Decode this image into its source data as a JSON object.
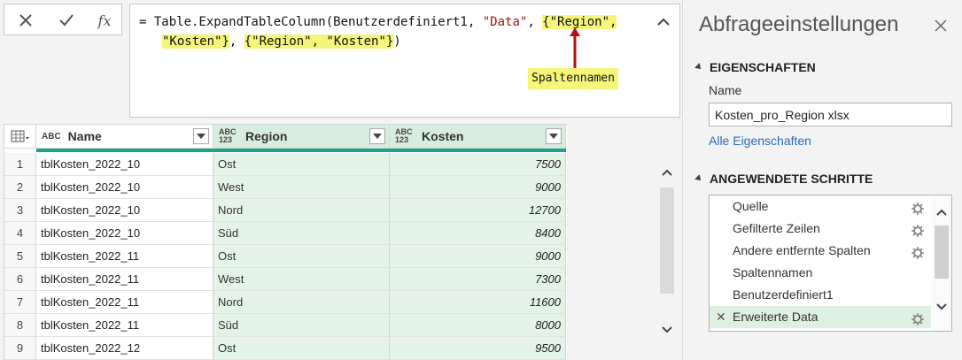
{
  "formula_bar": {
    "cancel_icon": "x-icon",
    "confirm_icon": "check-icon",
    "fx_label": "fx",
    "line1_prefix": "= Table.ExpandTableColumn(Benutzerdefiniert1, ",
    "line1_data": "\"Data\"",
    "line1_sep": ", ",
    "line1_hl": "{\"Region\",",
    "line2_hl": "\"Kosten\"}",
    "line2_mid": ", ",
    "line2_hl2": "{\"Region\", \"Kosten\"}",
    "line2_end": ")",
    "callout_label": "Spaltennamen",
    "highlight_color": "#f5f57a"
  },
  "grid": {
    "columns": [
      {
        "type_icon": "ABC",
        "label": "Name"
      },
      {
        "type_icon": "ABC 123",
        "label": "Region"
      },
      {
        "type_icon": "ABC 123",
        "label": "Kosten"
      }
    ],
    "rows": [
      {
        "idx": "1",
        "name": "tblKosten_2022_10",
        "region": "Ost",
        "kosten": "7500"
      },
      {
        "idx": "2",
        "name": "tblKosten_2022_10",
        "region": "West",
        "kosten": "9000"
      },
      {
        "idx": "3",
        "name": "tblKosten_2022_10",
        "region": "Nord",
        "kosten": "12700"
      },
      {
        "idx": "4",
        "name": "tblKosten_2022_10",
        "region": "Süd",
        "kosten": "8400"
      },
      {
        "idx": "5",
        "name": "tblKosten_2022_11",
        "region": "Ost",
        "kosten": "9000"
      },
      {
        "idx": "6",
        "name": "tblKosten_2022_11",
        "region": "West",
        "kosten": "7300"
      },
      {
        "idx": "7",
        "name": "tblKosten_2022_11",
        "region": "Nord",
        "kosten": "11600"
      },
      {
        "idx": "8",
        "name": "tblKosten_2022_11",
        "region": "Süd",
        "kosten": "8000"
      },
      {
        "idx": "9",
        "name": "tblKosten_2022_12",
        "region": "Ost",
        "kosten": "9500"
      }
    ],
    "accent_color": "#1ba38e"
  },
  "panel": {
    "title": "Abfrageeinstellungen",
    "properties_heading": "EIGENSCHAFTEN",
    "name_label": "Name",
    "name_value": "Kosten_pro_Region xlsx",
    "all_properties_link": "Alle Eigenschaften",
    "steps_heading": "ANGEWENDETE SCHRITTE",
    "steps": [
      {
        "label": "Quelle",
        "gear": true
      },
      {
        "label": "Gefilterte Zeilen",
        "gear": true
      },
      {
        "label": "Andere entfernte Spalten",
        "gear": true
      },
      {
        "label": "Spaltennamen",
        "gear": false
      },
      {
        "label": "Benutzerdefiniert1",
        "gear": false
      },
      {
        "label": "Erweiterte Data",
        "gear": true,
        "selected": true
      }
    ]
  }
}
